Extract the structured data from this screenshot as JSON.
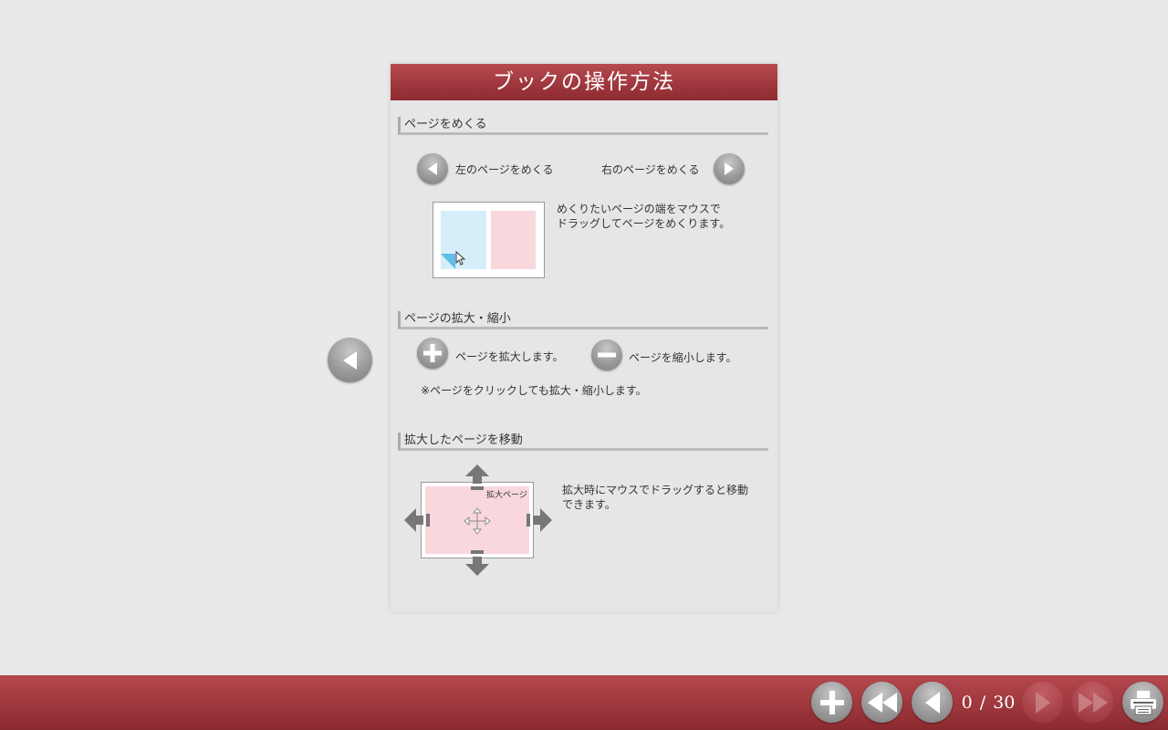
{
  "panel": {
    "title": "ブックの操作方法",
    "sections": {
      "turn": {
        "heading": "ページをめくる",
        "left_label": "左のページをめくる",
        "right_label": "右のページをめくる",
        "drag_desc_line1": "めくりたいページの端をマウスで",
        "drag_desc_line2": "ドラッグしてページをめくります。"
      },
      "zoom": {
        "heading": "ページの拡大・縮小",
        "zoom_in_label": "ページを拡大します。",
        "zoom_out_label": "ページを縮小します。",
        "note": "※ページをクリックしても拡大・縮小します。"
      },
      "move": {
        "heading": "拡大したページを移動",
        "page_label": "拡大ページ",
        "desc_line1": "拡大時にマウスでドラッグすると移動",
        "desc_line2": "できます。"
      }
    }
  },
  "toolbar": {
    "current_page": "0",
    "separator": "/",
    "total_pages": "30"
  },
  "colors": {
    "accent": "#9c343a",
    "page_blue": "#d6eefa",
    "page_pink": "#f8d8dc"
  }
}
